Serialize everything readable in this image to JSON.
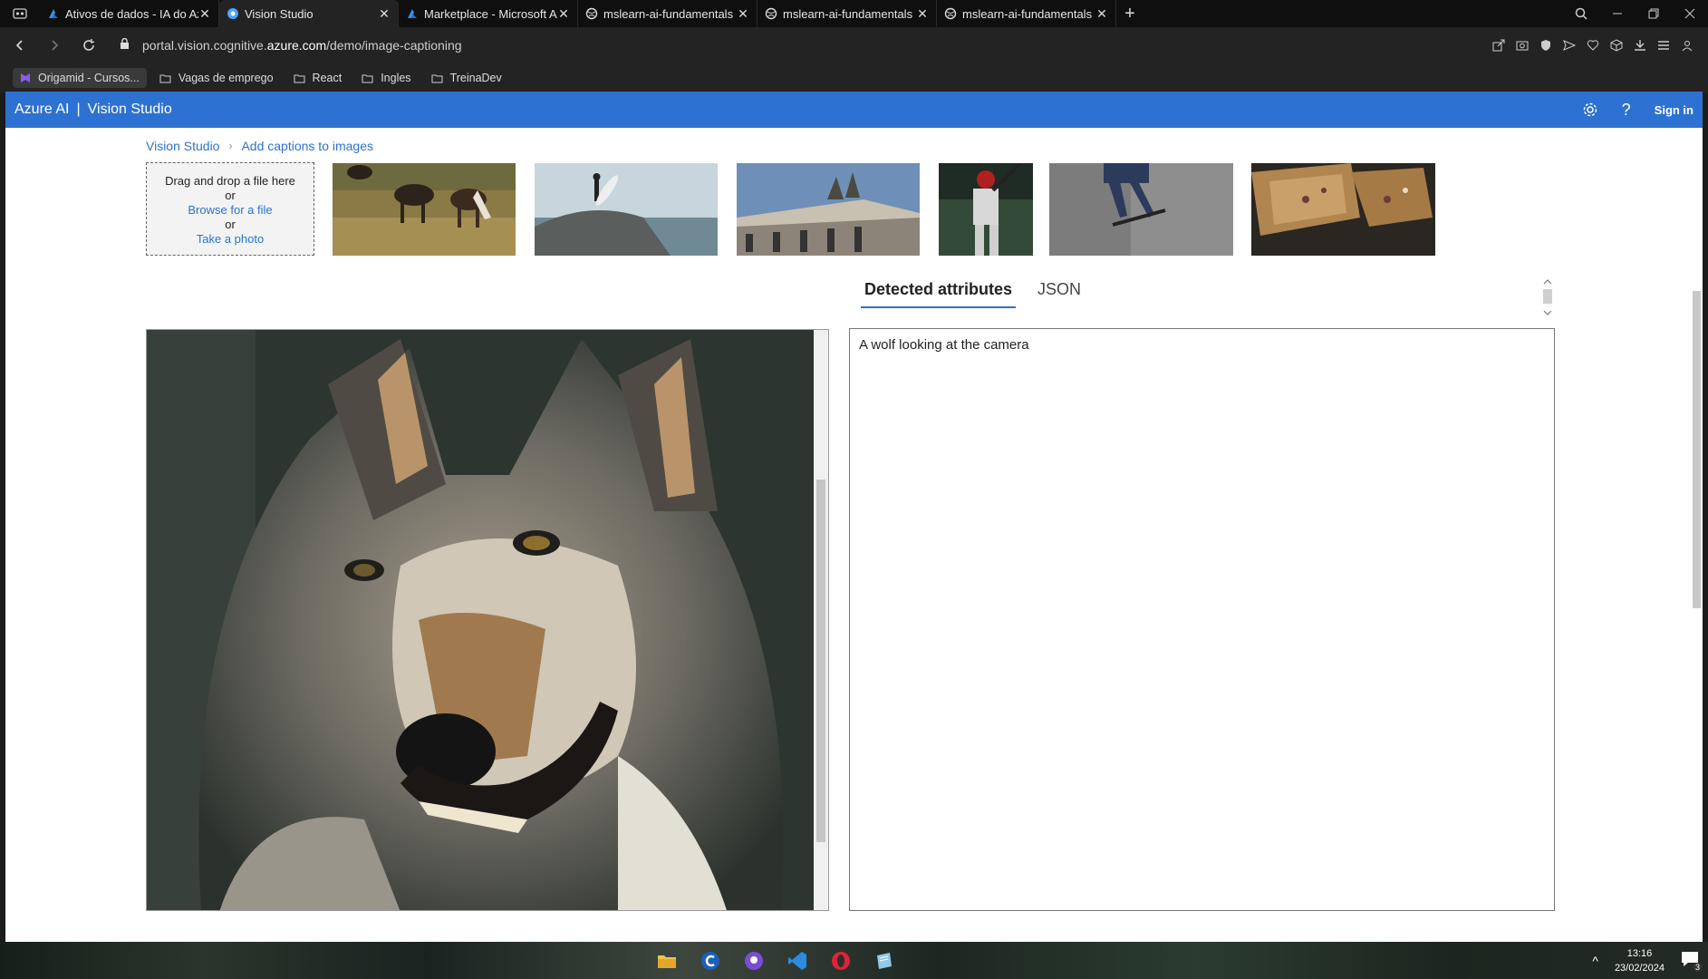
{
  "browser": {
    "tabs": [
      {
        "label": "Ativos de dados - IA do Azure"
      },
      {
        "label": "Vision Studio"
      },
      {
        "label": "Marketplace - Microsoft Azure"
      },
      {
        "label": "mslearn-ai-fundamentals"
      },
      {
        "label": "mslearn-ai-fundamentals"
      },
      {
        "label": "mslearn-ai-fundamentals"
      }
    ],
    "url_prefix": "portal.vision.cognitive.",
    "url_domain": "azure.com",
    "url_path": "/demo/image-captioning",
    "bookmarks": [
      "Origamid - Cursos...",
      "Vagas de emprego",
      "React",
      "Ingles",
      "TreinaDev"
    ]
  },
  "app": {
    "brand": "Azure AI",
    "brand_sep": "|",
    "product": "Vision Studio",
    "signin": "Sign in"
  },
  "breadcrumb": {
    "root": "Vision Studio",
    "current": "Add captions to images"
  },
  "upload": {
    "line1": "Drag and drop a file here",
    "or1": "or",
    "browse": "Browse for a file",
    "or2": "or",
    "photo": "Take a photo"
  },
  "results": {
    "tab_attributes": "Detected attributes",
    "tab_json": "JSON",
    "caption": "A wolf looking at the camera"
  },
  "taskbar": {
    "time": "13:16",
    "date": "23/02/2024",
    "notifications": "3"
  }
}
